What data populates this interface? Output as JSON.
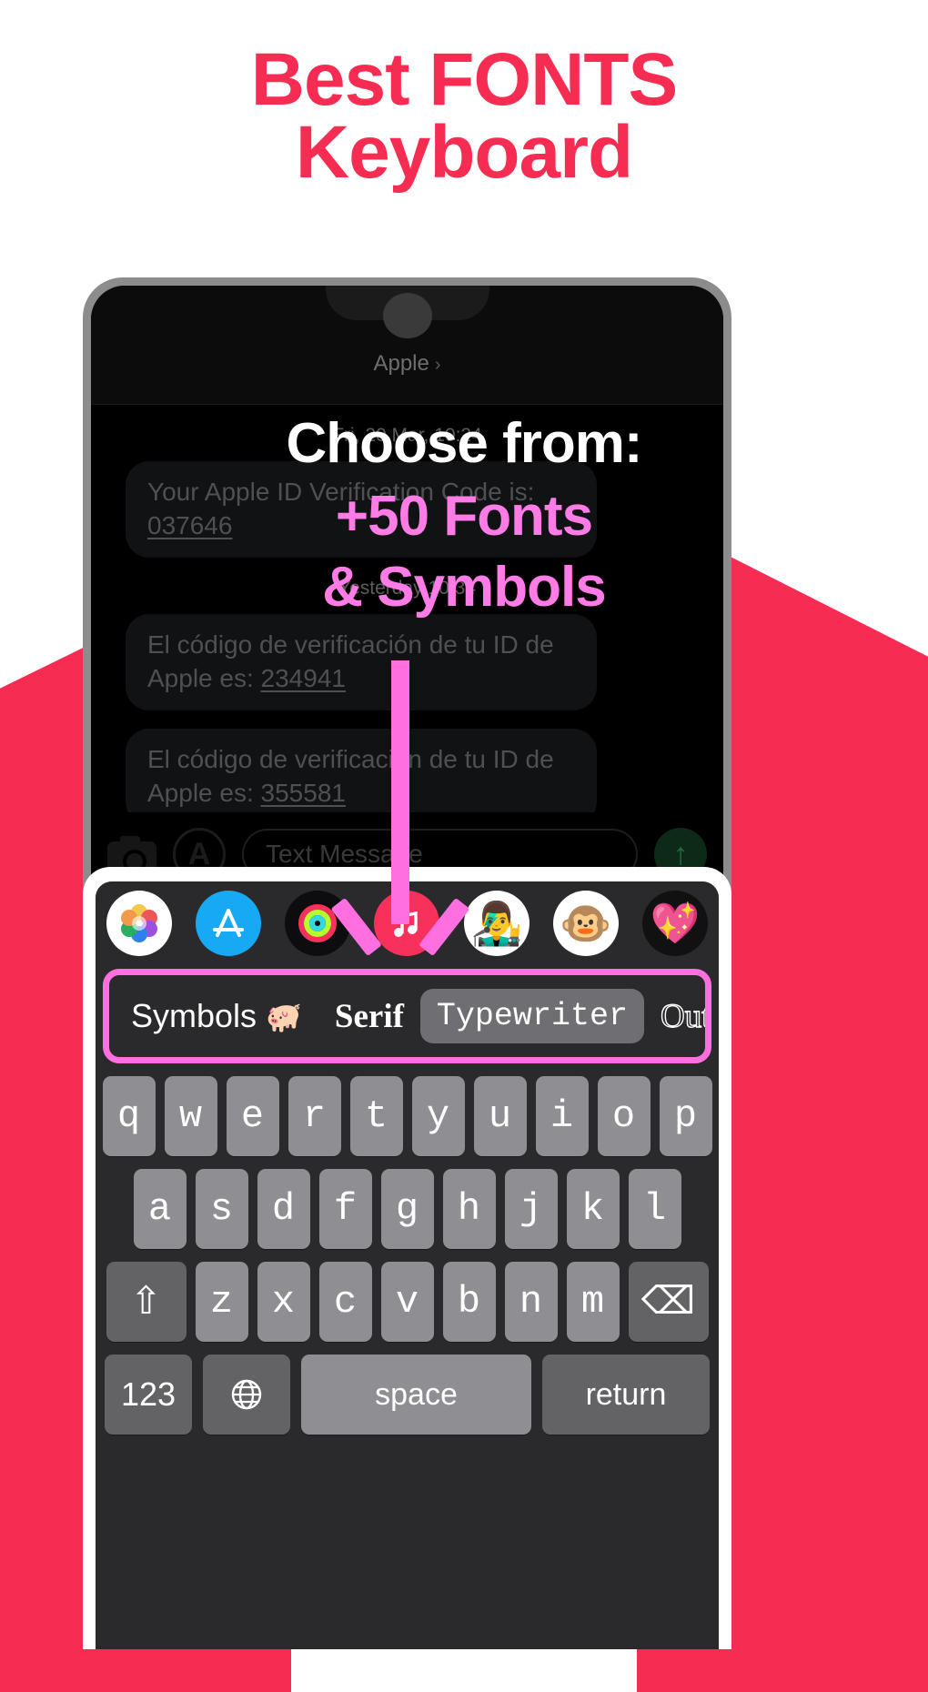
{
  "headline": {
    "line1": "Best FONTS",
    "line2": "Keyboard",
    "color": "#F72C52"
  },
  "overlay": {
    "choose": "Choose from:",
    "fonts": "+50 Fonts",
    "symbols": "& Symbols",
    "choose_color": "#FFFFFF",
    "accent_color": "#FF7BE6"
  },
  "phone": {
    "messages": {
      "contact_name": "Apple",
      "contact_chevron": "›",
      "timestamps": [
        "Fri, 20 Mar, 10:24",
        "Yesterday 10:34"
      ],
      "bubbles": [
        {
          "text": "Your Apple ID Verification Code is: ",
          "code": "037646"
        },
        {
          "text": "El código de verificación de tu ID de Apple es: ",
          "code": "234941"
        },
        {
          "text": "El código de verificación de tu ID de Apple es: ",
          "code": "355581"
        }
      ],
      "input_placeholder": "Text Message",
      "camera_icon": "camera-icon",
      "appstore_icon": "app-store-icon",
      "send_icon": "↑"
    },
    "keyboard": {
      "app_strip": [
        {
          "name": "photos-app-icon",
          "glyph": "❀"
        },
        {
          "name": "app-store-icon",
          "glyph": "A"
        },
        {
          "name": "fitness-rings-icon",
          "glyph": "◎"
        },
        {
          "name": "music-app-icon",
          "glyph": "♪"
        },
        {
          "name": "memoji-icon",
          "glyph": "👨"
        },
        {
          "name": "monkey-sticker-icon",
          "glyph": "🐵"
        },
        {
          "name": "heart-sticker-icon",
          "glyph": "💖"
        }
      ],
      "font_options": [
        {
          "label": "Symbols",
          "style": "symbols",
          "selected": false,
          "extra": "🐗"
        },
        {
          "label": "Serif",
          "style": "serif",
          "selected": false
        },
        {
          "label": "Typewriter",
          "style": "typewriter",
          "selected": true
        },
        {
          "label": "Outline",
          "style": "outline",
          "selected": false
        }
      ],
      "highlight_color": "#FF6FE0",
      "row1": [
        "q",
        "w",
        "e",
        "r",
        "t",
        "y",
        "u",
        "i",
        "o",
        "p"
      ],
      "row2": [
        "a",
        "s",
        "d",
        "f",
        "g",
        "h",
        "j",
        "k",
        "l"
      ],
      "row3": [
        "z",
        "x",
        "c",
        "v",
        "b",
        "n",
        "m"
      ],
      "shift_key": "⇧",
      "backspace_key": "⌫",
      "numbers_key": "123",
      "globe_key": "⊕",
      "space_key": "space",
      "return_key": "return"
    }
  }
}
